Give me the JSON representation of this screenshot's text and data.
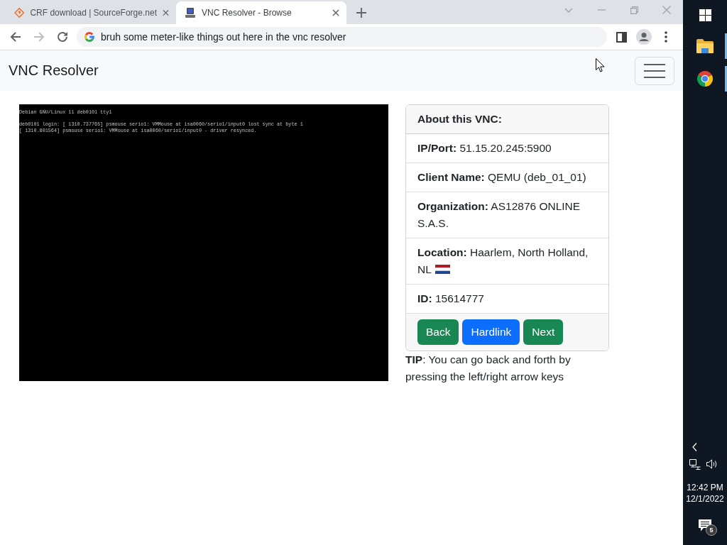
{
  "browser": {
    "tabs": [
      {
        "title": "CRF download | SourceForge.net",
        "selected": false
      },
      {
        "title": "VNC Resolver - Browse",
        "selected": true
      }
    ],
    "nav": {
      "back_disabled": false,
      "forward_disabled": true
    },
    "address": "bruh some meter-like things out here in the vnc resolver"
  },
  "navbar": {
    "brand": "VNC Resolver"
  },
  "screenshot": {
    "banner": "Debian GNU/Linux 11 deb0101 tty1",
    "log": [
      "deb0101 login: [ 1310.737765] psmouse serio1: VMMouse at isa0060/serio1/input0 lost sync at byte 1",
      "[ 1310.801564] psmouse serio1: VMMouse at isa0060/serio1/input0 - driver resynced."
    ]
  },
  "card": {
    "header": "About this VNC:",
    "rows": [
      {
        "text": "**IP/Port:** 51.15.20.245:5900",
        "flag": false
      },
      {
        "text": "**Client Name:** QEMU (deb_01_01)",
        "flag": false
      },
      {
        "text": "**Organization:** AS12876 ONLINE S.A.S.",
        "flag": false
      },
      {
        "text": "**Location:** Haarlem, North Holland, NL",
        "flag": true
      },
      {
        "text": "**ID:** 15614777",
        "flag": false
      }
    ],
    "buttons": [
      {
        "label": "Back",
        "kind": "success"
      },
      {
        "label": "Hardlink",
        "kind": "primary"
      },
      {
        "label": "Next",
        "kind": "success"
      }
    ]
  },
  "tip": "**TIP**: You can go back and forth by pressing the left/right arrow keys",
  "taskbar": {
    "apps": [
      {
        "running": true
      },
      {
        "running": true
      }
    ],
    "time": "12:42 PM",
    "date": "12/1/2022",
    "notifications": "5"
  }
}
